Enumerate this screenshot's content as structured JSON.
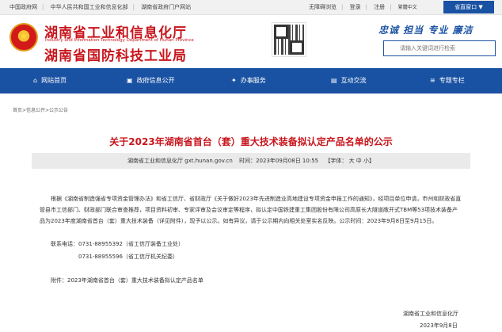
{
  "topbar": {
    "links": [
      "中国政府网",
      "中华人民共和国工业和信息化部",
      "湖南省政府门户网站"
    ],
    "accessibility": "无障碍浏览",
    "login": "登录",
    "register": "注册",
    "language": "繁體中文",
    "portal": "省直窗口 ▼"
  },
  "header": {
    "title_line1": "湖南省工业和信息化厅",
    "title_en": "Industry and Information Technology Department of Hunan Province",
    "title_line2": "湖南省国防科技工业局",
    "slogan": "忠诚 担当 专业 廉洁",
    "search_placeholder": "请输入关键词进行检索"
  },
  "nav": {
    "items": [
      {
        "label": "网站首页",
        "icon": "home-icon",
        "glyph": "⌂"
      },
      {
        "label": "政府信息公开",
        "icon": "document-icon",
        "glyph": "▣"
      },
      {
        "label": "办事服务",
        "icon": "handshake-icon",
        "glyph": "✦"
      },
      {
        "label": "互动交流",
        "icon": "chat-icon",
        "glyph": "▤"
      },
      {
        "label": "专题专栏",
        "icon": "layers-icon",
        "glyph": "≋"
      }
    ]
  },
  "breadcrumb": "首页>信息公开>公示公告",
  "article": {
    "title": "关于2023年湖南省首台（套）重大技术装备拟认定产品名单的公示",
    "meta_source": "湖南省工业和信息化厅 gxt.hunan.gov.cn",
    "meta_time": "时间：2023年09月08日 10:55",
    "meta_font": "【字体： 大  中  小】",
    "paragraph": "根据《湖南省制造强省专项资金管理办法》和省工信厅、省财政厅《关于做好2023年先进制造业高地建设专项资金申报工作的通知》，经项目单位申请，市州和财政省直管县市工信部门、财政部门联合审查推荐，项目资料初审、专家评审及会议审定等程序，拟认定中国铁建重工集团股份有限公司高原长大隧道敞开式TBM等53项技术装备产品为2023年度湖南省首台（套）重大技术装备（详见附件），现予以公示。如有异议，请于公示期内向相关处室实名反映。公示时间：2023年9月8日至9月15日。",
    "contact_label": "联系电话：",
    "contact_1": "0731-88955392（省工信厅装备工业处）",
    "contact_2": "0731-88955596（省工信厅机关纪委）",
    "attachment": "附件：2023年湖南省首台（套）重大技术装备拟认定产品名单",
    "signature_org": "湖南省工业和信息化厅",
    "signature_date": "2023年9月8日"
  },
  "colors": {
    "brand_blue": "#1a52a3",
    "brand_red": "#c8161d",
    "meta_bg": "#eaeaea"
  }
}
